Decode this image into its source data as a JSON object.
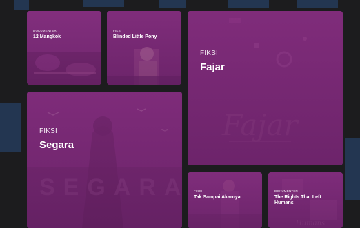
{
  "colors": {
    "page_bg": "#1c1c1e",
    "card_tint": "#7a2d77",
    "text": "#ffffff"
  },
  "cards": [
    {
      "category": "DOKUMENTER",
      "title": "12 Mangkok"
    },
    {
      "category": "FIKSI",
      "title": "Blinded Little Pony"
    },
    {
      "category": "FIKSI",
      "title": "Fajar"
    },
    {
      "category": "FIKSI",
      "title": "Segara"
    },
    {
      "category": "FIKSI",
      "title": "Tak Sampai Akarnya"
    },
    {
      "category": "DOKUMENTER",
      "title": "The Rights That Left Humans"
    }
  ]
}
